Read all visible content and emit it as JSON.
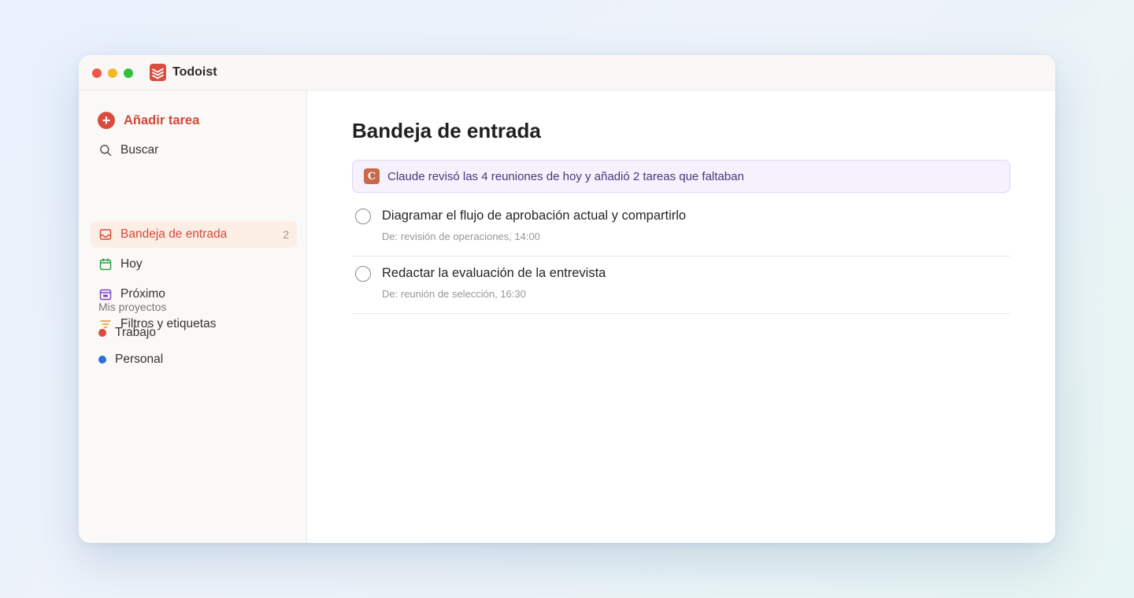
{
  "window": {
    "app_title": "Todoist"
  },
  "sidebar": {
    "add_task_label": "Añadir tarea",
    "nav": [
      {
        "label": "Buscar",
        "icon": "search-icon"
      },
      {
        "label": "Bandeja de entrada",
        "icon": "inbox-icon",
        "count": "2",
        "active": true
      },
      {
        "label": "Hoy",
        "icon": "calendar-today-icon"
      },
      {
        "label": "Próximo",
        "icon": "calendar-upcoming-icon"
      },
      {
        "label": "Filtros y etiquetas",
        "icon": "filter-icon"
      }
    ],
    "projects_title": "Mis proyectos",
    "projects": [
      {
        "label": "Trabajo",
        "color": "#dc4c3e"
      },
      {
        "label": "Personal",
        "color": "#2f6ed8"
      }
    ]
  },
  "main": {
    "title": "Bandeja de entrada",
    "notice": {
      "badge": "C",
      "text": "Claude revisó las 4 reuniones de hoy y añadió 2 tareas que faltaban"
    },
    "tasks": [
      {
        "title": "Diagramar el flujo de aprobación actual y compartirlo",
        "meta": "De: revisión de operaciones, 14:00"
      },
      {
        "title": "Redactar la evaluación de la entrevista",
        "meta": "De: reunión de selección, 16:30"
      }
    ]
  },
  "colors": {
    "accent": "#dc4c3e",
    "active_bg": "#fdeee5",
    "notice_bg": "#f5f2fd",
    "notice_text": "#453a78",
    "today_icon": "#2f9e44",
    "upcoming_icon": "#7b46c8",
    "filter_icon": "#e8961c"
  }
}
